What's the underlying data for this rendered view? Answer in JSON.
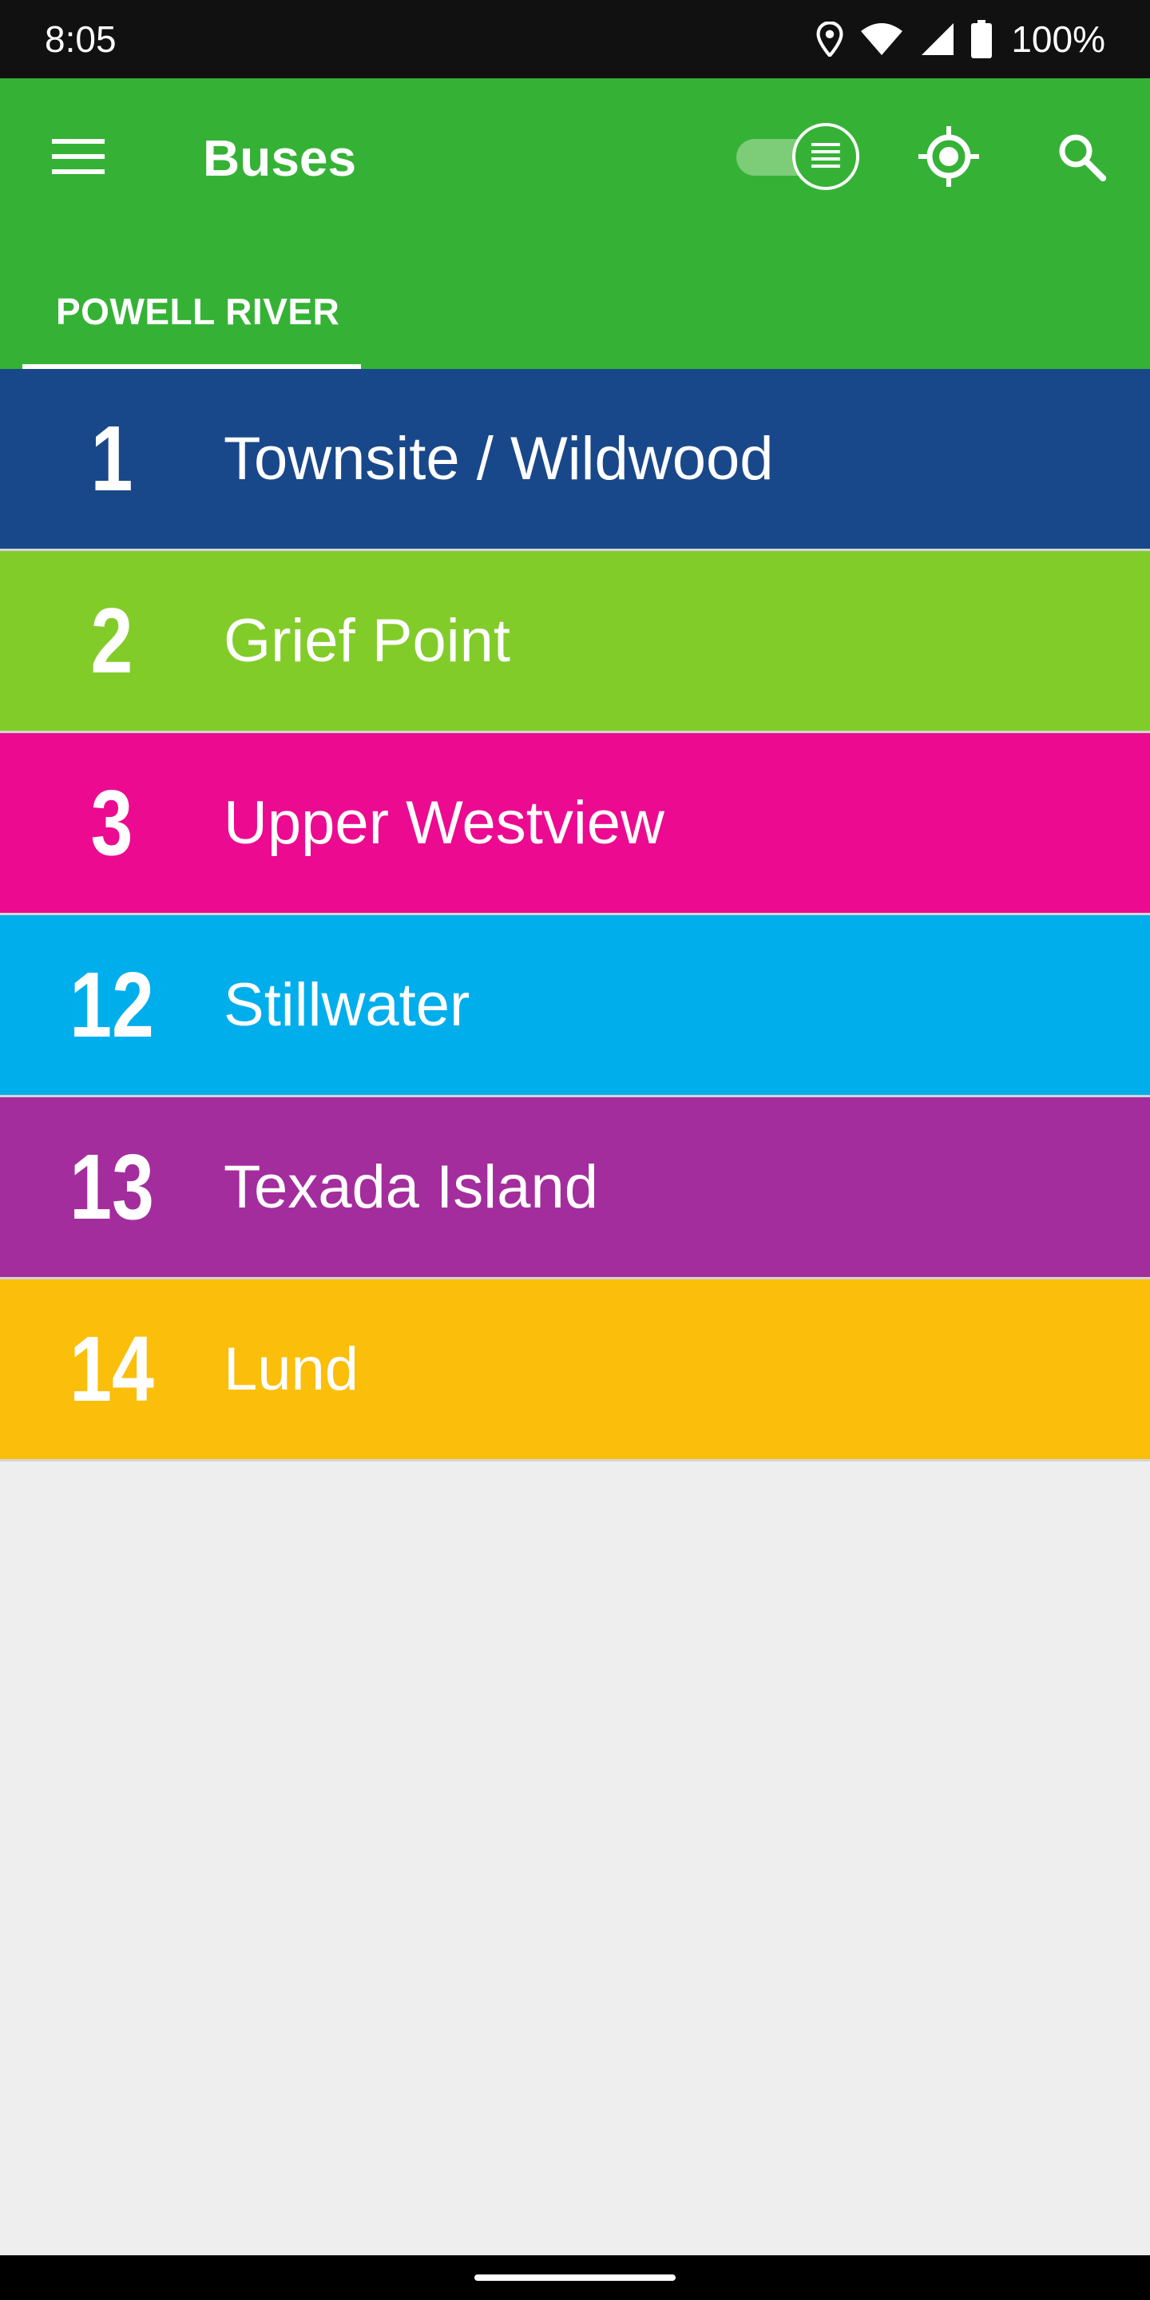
{
  "status_bar": {
    "time": "8:05",
    "battery": "100%",
    "icons": [
      "location-icon",
      "wifi-icon",
      "signal-icon",
      "battery-icon"
    ]
  },
  "app_bar": {
    "title": "Buses",
    "background_color": "#35B236",
    "menu_icon": "hamburger-menu-icon",
    "toggle_icon": "list-icon",
    "locate_icon": "my-location-icon",
    "search_icon": "search-icon"
  },
  "tabs": [
    {
      "label": "POWELL RIVER",
      "selected": true
    }
  ],
  "routes": [
    {
      "number": "1",
      "name": "Townsite / Wildwood",
      "color": "#19488A"
    },
    {
      "number": "2",
      "name": "Grief Point",
      "color": "#82CC2A"
    },
    {
      "number": "3",
      "name": "Upper Westview",
      "color": "#EC0A91"
    },
    {
      "number": "12",
      "name": "Stillwater",
      "color": "#00AEEC"
    },
    {
      "number": "13",
      "name": "Texada Island",
      "color": "#A32D9C"
    },
    {
      "number": "14",
      "name": "Lund",
      "color": "#FBBE0B"
    }
  ]
}
